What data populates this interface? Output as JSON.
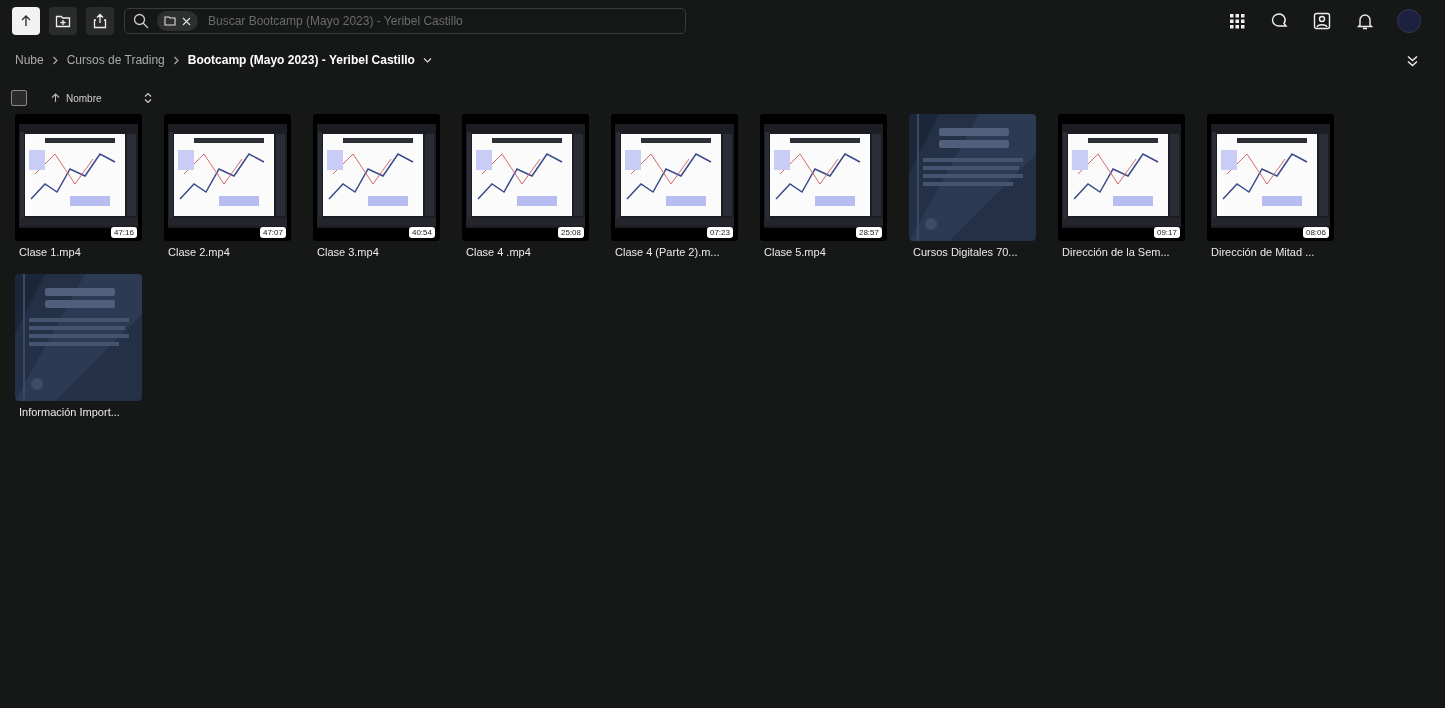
{
  "search": {
    "placeholder": "Buscar Bootcamp (Mayo 2023) - Yeribel Castillo"
  },
  "breadcrumbs": [
    {
      "label": "Nube",
      "current": false
    },
    {
      "label": "Cursos de Trading",
      "current": false
    },
    {
      "label": "Bootcamp (Mayo 2023) - Yeribel Castillo",
      "current": true
    }
  ],
  "select_all": {
    "checked": false
  },
  "sort": {
    "label": "Nombre"
  },
  "files": [
    {
      "name": "Clase 1.mp4",
      "kind": "video",
      "duration": "47:16"
    },
    {
      "name": "Clase 2.mp4",
      "kind": "video",
      "duration": "47:07"
    },
    {
      "name": "Clase 3.mp4",
      "kind": "video",
      "duration": "40:54"
    },
    {
      "name": "Clase 4 .mp4",
      "kind": "video",
      "duration": "25:08"
    },
    {
      "name": "Clase 4 (Parte 2).m...",
      "kind": "video",
      "duration": "07:23"
    },
    {
      "name": "Clase 5.mp4",
      "kind": "video",
      "duration": "28:57"
    },
    {
      "name": "Cursos Digitales 70..."
    },
    {
      "name": "Dirección de la Sem...",
      "kind": "video",
      "duration": "09:17"
    },
    {
      "name": "Dirección de Mitad ...",
      "kind": "video",
      "duration": "08:06"
    },
    {
      "name": "Información Import..."
    }
  ]
}
